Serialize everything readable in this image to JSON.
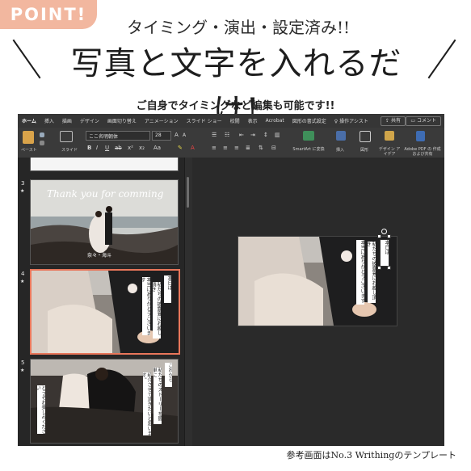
{
  "badge": "POINT!",
  "subtitle": "タイミング・演出・設定済み!!",
  "headline": "写真と文字を入れるだけ!",
  "caption": "ご自身でタイミングなど編集も可能です!!",
  "footer": "参考画面はNo.3 Writhingのテンプレート",
  "app": {
    "tabs": [
      "ホーム",
      "挿入",
      "描画",
      "デザイン",
      "画面切り替え",
      "アニメーション",
      "スライド ショー",
      "校閲",
      "表示",
      "Acrobat",
      "図形の書式設定"
    ],
    "assist": "操作アシスト",
    "share": "共有",
    "comment": "コメント",
    "ribbon": {
      "paste": "ペースト",
      "slide": "スライド",
      "font": "ここ名明朝体",
      "size": "28",
      "smartart": "SmartArt に変換",
      "insert": "挿入",
      "shape": "図形",
      "design_ideas": "デザイン アイデア",
      "adobe": "Adobe PDF の 作成および共有"
    },
    "slides": [
      {
        "number": "3",
        "script": "Thank you for comming",
        "names": "奈々・海斗"
      },
      {
        "number": "4",
        "text_a": "本日は",
        "text_b": "私たちの披露宴にお越し頂き",
        "text_c": "本当にありがとうございます"
      },
      {
        "number": "5",
        "text_a": "これから",
        "text_b": "私たちのストーリーを簡単に",
        "text_c": "紹介させて頂きたいと思います。",
        "text_d": "どうぞお楽しみください"
      }
    ],
    "editor": {
      "text_a": "本日は",
      "text_b": "私たちの披露宴にお越し頂き",
      "text_c": "本当にありがとうございます"
    }
  }
}
